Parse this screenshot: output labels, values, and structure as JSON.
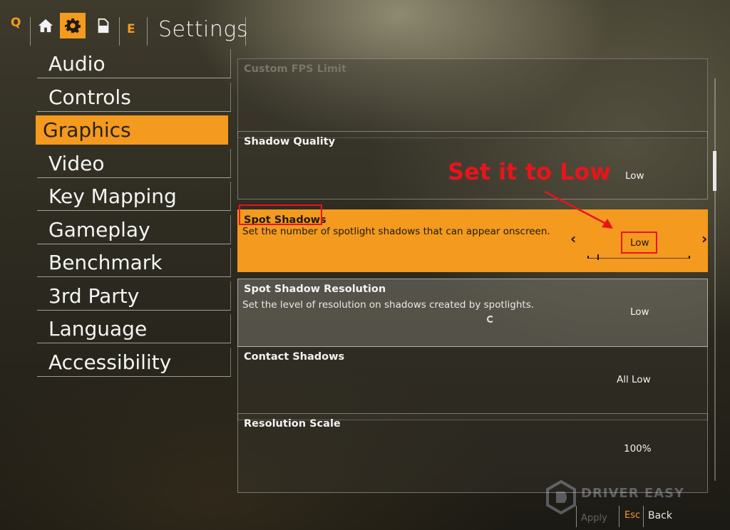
{
  "topbar": {
    "left_key": "Q",
    "right_key": "E",
    "title": "Settings",
    "icons": [
      "home-icon",
      "gear-icon",
      "document-icon"
    ]
  },
  "sidebar": {
    "items": [
      {
        "label": "Audio"
      },
      {
        "label": "Controls"
      },
      {
        "label": "Graphics",
        "active": true
      },
      {
        "label": "Video"
      },
      {
        "label": "Key Mapping"
      },
      {
        "label": "Gameplay"
      },
      {
        "label": "Benchmark"
      },
      {
        "label": "3rd Party"
      },
      {
        "label": "Language"
      },
      {
        "label": "Accessibility"
      }
    ]
  },
  "settings": {
    "custom_fps": {
      "label": "Custom FPS Limit"
    },
    "shadow_quality": {
      "label": "Shadow Quality",
      "value": "Low"
    },
    "spot_shadows": {
      "label": "Spot Shadows",
      "description": "Set the number of spotlight shadows that can appear onscreen.",
      "value": "Low",
      "prev": "‹",
      "next": "›"
    },
    "spot_shadow_resolution": {
      "label": "Spot Shadow Resolution",
      "description": "Set the level of resolution on shadows created by spotlights.",
      "value": "Low"
    },
    "contact_shadows": {
      "label": "Contact Shadows",
      "value": "All Low"
    },
    "resolution_scale": {
      "label": "Resolution Scale",
      "value": "100%"
    }
  },
  "annotation": {
    "callout": "Set it to Low"
  },
  "bottom": {
    "watermark": "DRIVER EASY",
    "apply_label": "Apply",
    "esc_key": "Esc",
    "back_label": "Back"
  },
  "colors": {
    "accent": "#f39a1f",
    "annotation_red": "#e8141c"
  }
}
